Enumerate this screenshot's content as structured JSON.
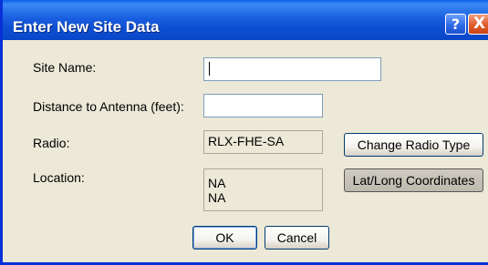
{
  "window": {
    "title": "Enter New Site Data",
    "help_glyph": "?",
    "close_glyph": "X"
  },
  "form": {
    "site_name_label": "Site Name:",
    "site_name_value": "",
    "distance_label": "Distance to Antenna (feet):",
    "distance_value": "",
    "radio_label": "Radio:",
    "radio_value": "RLX-FHE-SA",
    "location_label": "Location:",
    "location_line1": "NA",
    "location_line2": "NA"
  },
  "buttons": {
    "change_radio": "Change Radio Type",
    "lat_long": "Lat/Long Coordinates",
    "ok": "OK",
    "cancel": "Cancel"
  },
  "icons": {
    "help": "help-icon",
    "close": "close-icon"
  },
  "colors": {
    "titlebar": "#0a47c8",
    "dialog_bg": "#ece9d8",
    "close_button": "#e05a28"
  }
}
